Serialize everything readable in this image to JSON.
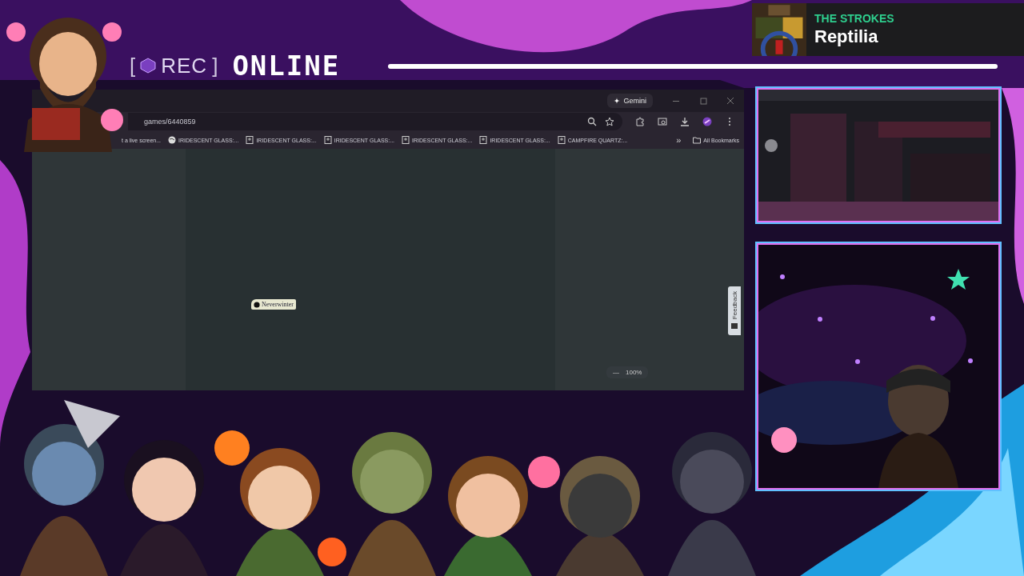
{
  "overlay": {
    "rec_open": "[",
    "rec_label": "REC",
    "rec_close": "]",
    "status": "ONLINE"
  },
  "now_playing": {
    "artist": "THE STROKES",
    "title": "Reptilia"
  },
  "browser": {
    "gemini_button": "Gemini",
    "address": "games/6440859",
    "bookmarks": [
      {
        "label": "t a live screen...",
        "kind": "none"
      },
      {
        "label": "IRIDESCENT GLASS:...",
        "kind": "globe"
      },
      {
        "label": "IRIDESCENT GLASS:...",
        "kind": "page"
      },
      {
        "label": "IRIDESCENT GLASS:...",
        "kind": "page"
      },
      {
        "label": "IRIDESCENT GLASS:...",
        "kind": "page"
      },
      {
        "label": "IRIDESCENT GLASS:...",
        "kind": "page"
      },
      {
        "label": "CAMPFIRE QUARTZ:...",
        "kind": "page"
      }
    ],
    "overflow": "»",
    "all_bookmarks": "All Bookmarks",
    "map_label": "Neverwinter",
    "feedback": "Feedback",
    "zoom": {
      "minus": "—",
      "value": "100%"
    }
  }
}
